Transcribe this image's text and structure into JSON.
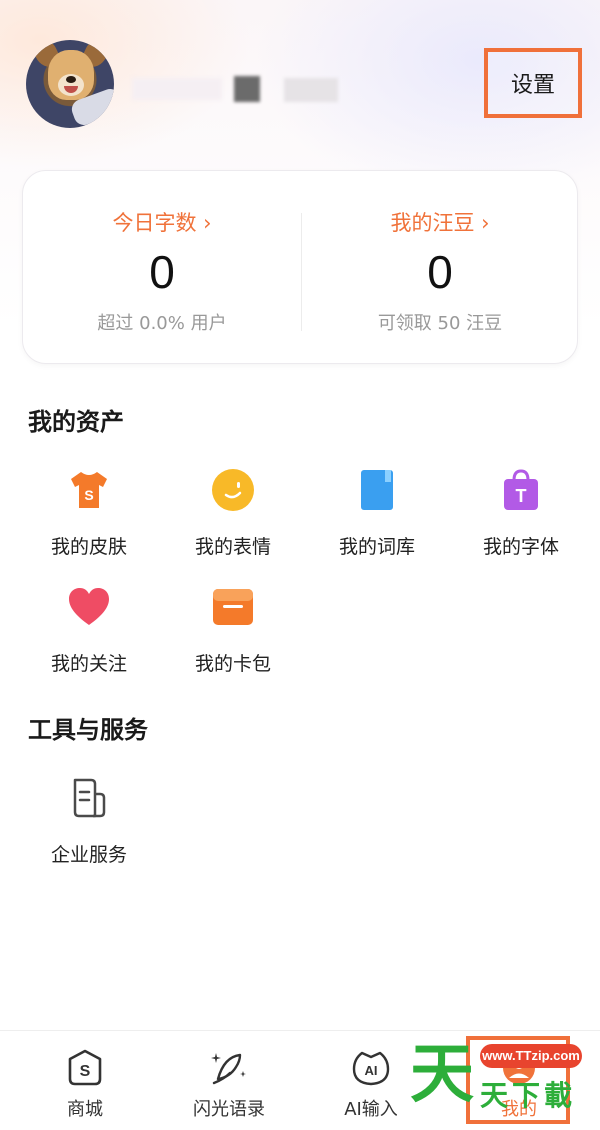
{
  "header": {
    "avatar_alt": "avatar",
    "settings_label": "设置"
  },
  "stats": {
    "left": {
      "title": "今日字数",
      "value": "0",
      "sub": "超过 0.0% 用户"
    },
    "right": {
      "title": "我的汪豆",
      "value": "0",
      "sub": "可领取 50 汪豆"
    }
  },
  "assets": {
    "title": "我的资产",
    "items": [
      {
        "label": "我的皮肤",
        "icon": "tshirt-icon",
        "color": "#f47a2a"
      },
      {
        "label": "我的表情",
        "icon": "smiley-icon",
        "color": "#f8b928"
      },
      {
        "label": "我的词库",
        "icon": "book-icon",
        "color": "#3a9ff0"
      },
      {
        "label": "我的字体",
        "icon": "shopping-bag-icon",
        "color": "#b25ae6"
      },
      {
        "label": "我的关注",
        "icon": "heart-icon",
        "color": "#ef4c64"
      },
      {
        "label": "我的卡包",
        "icon": "wallet-icon",
        "color": "#f47a2a"
      }
    ]
  },
  "tools": {
    "title": "工具与服务",
    "items": [
      {
        "label": "企业服务",
        "icon": "document-icon"
      }
    ]
  },
  "tabbar": {
    "items": [
      {
        "label": "商城",
        "icon": "store-icon"
      },
      {
        "label": "闪光语录",
        "icon": "quill-icon"
      },
      {
        "label": "AI输入",
        "icon": "ai-icon"
      },
      {
        "label": "我的",
        "icon": "profile-icon"
      }
    ],
    "active_color": "#f0723a"
  },
  "watermark": {
    "big": "天",
    "url": "www.TTzip.com",
    "text": "天下載"
  },
  "colors": {
    "accent": "#f0723a",
    "highlight_box": "#f0703a"
  }
}
